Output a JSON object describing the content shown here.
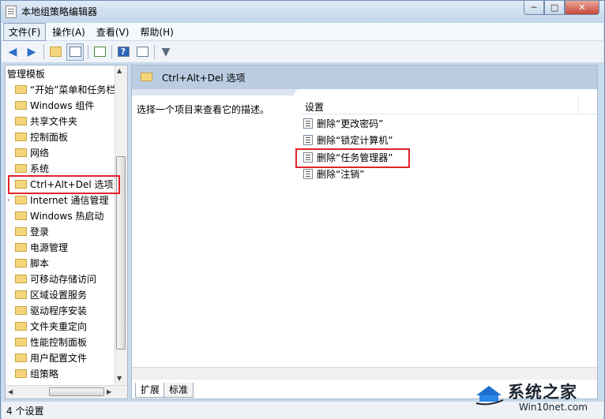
{
  "window": {
    "title": "本地组策略编辑器"
  },
  "menu": [
    {
      "label": "文件(F)",
      "active": true
    },
    {
      "label": "操作(A)"
    },
    {
      "label": "查看(V)"
    },
    {
      "label": "帮助(H)"
    }
  ],
  "tree": {
    "root": "管理模板",
    "items": [
      "“开始”菜单和任务栏",
      "Windows 组件",
      "共享文件夹",
      "控制面板",
      "网络",
      "系统"
    ],
    "system_children": [
      "Ctrl+Alt+Del 选项",
      "Internet 通信管理",
      "Windows 热启动",
      "登录",
      "电源管理",
      "脚本",
      "可移动存储访问",
      "区域设置服务",
      "驱动程序安装",
      "文件夹重定向",
      "性能控制面板",
      "用户配置文件",
      "组策略"
    ]
  },
  "right": {
    "header_title": "Ctrl+Alt+Del 选项",
    "description": "选择一个项目来查看它的描述。",
    "column": "设置",
    "settings": [
      "删除“更改密码”",
      "删除“锁定计算机”",
      "删除“任务管理器”",
      "删除“注销”"
    ],
    "tabs": [
      "扩展",
      "标准"
    ]
  },
  "status": {
    "text": "4 个设置"
  },
  "watermark": {
    "title": "系统之家",
    "site": "Win10net.com"
  },
  "colors": {
    "highlight_box": "#e0232b",
    "header_bg": "#b9cce2",
    "folder": "#f5d57c"
  }
}
